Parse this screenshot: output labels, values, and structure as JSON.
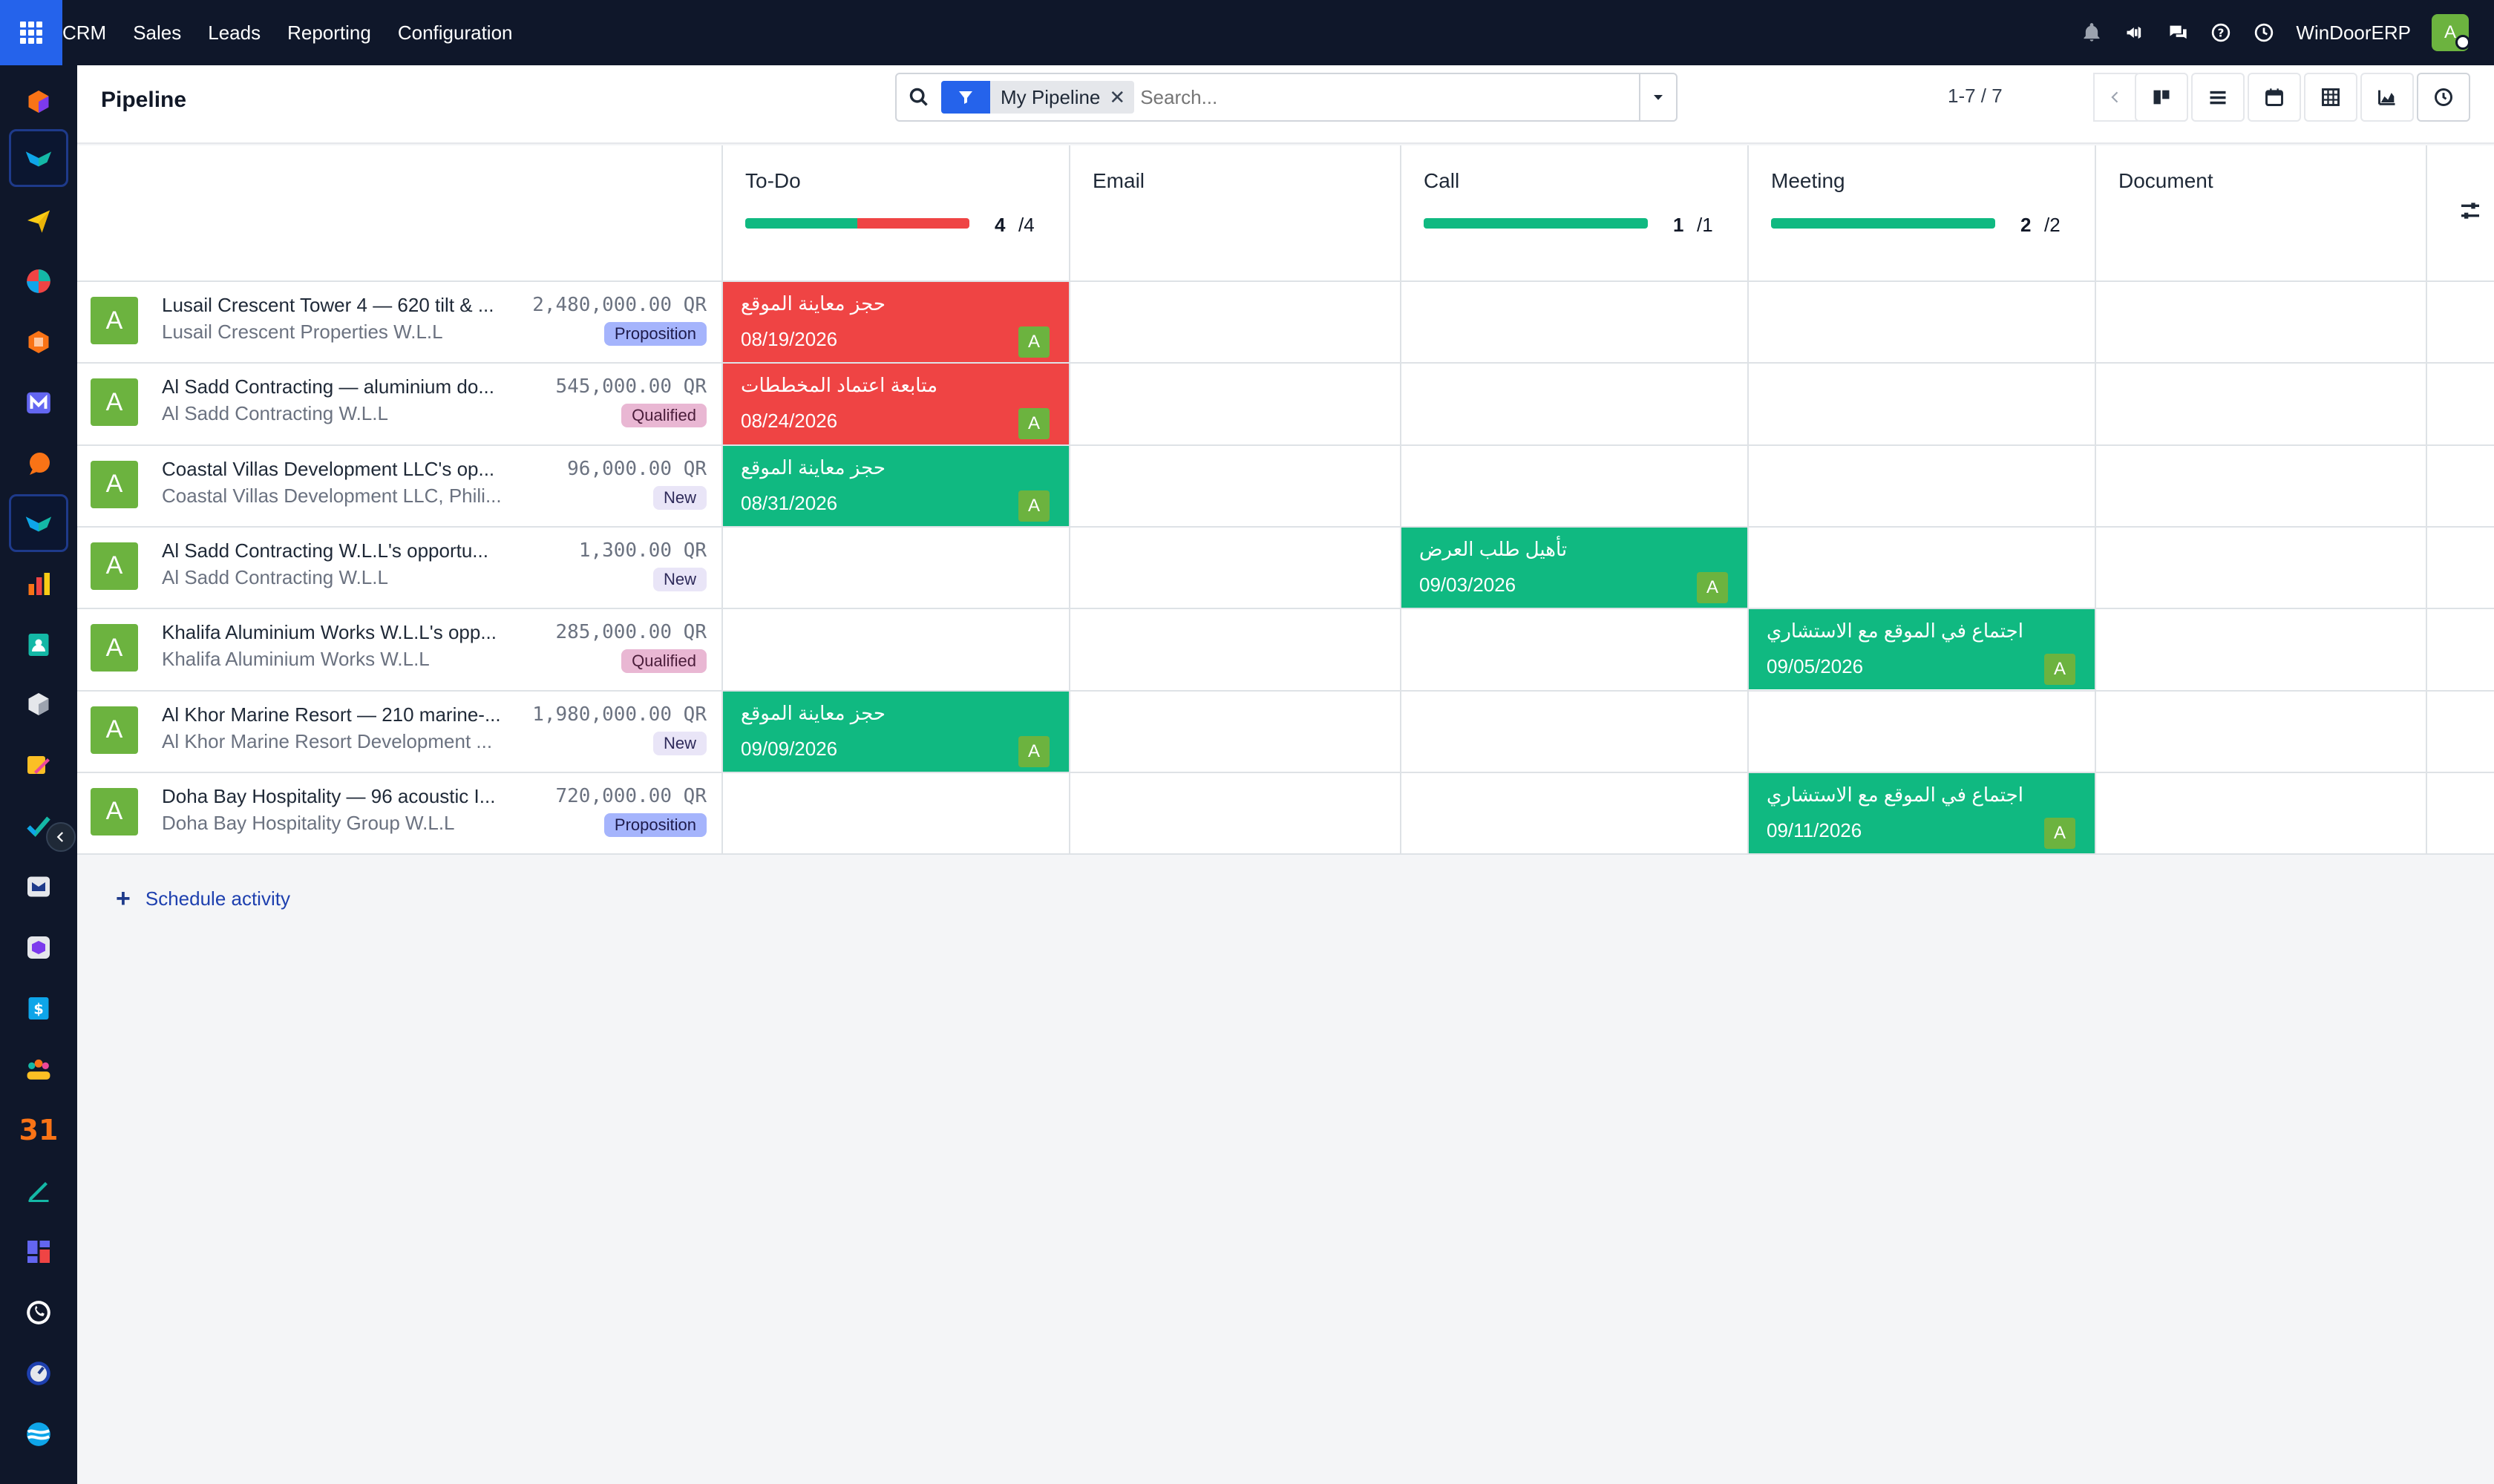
{
  "topnav": {
    "brand": "CRM",
    "menu": [
      "Sales",
      "Leads",
      "Reporting",
      "Configuration"
    ],
    "company": "WinDoorERP",
    "user_initial": "A",
    "icons": [
      "bell-icon",
      "megaphone-icon",
      "chat-icon",
      "help-icon",
      "clock-icon"
    ]
  },
  "sidebar": {
    "apps": [
      "cube-app",
      "crm-app",
      "send-app",
      "pie-app",
      "box-app",
      "mail-app",
      "chat-app",
      "crm-app-2",
      "chart-app",
      "contacts-app",
      "package-app",
      "sign-app",
      "task-app",
      "knowledge-app",
      "inventory-app",
      "invoice-app",
      "team-app",
      "calendar-app",
      "pen-app",
      "dashboard-app",
      "whatsapp-app",
      "compass-app",
      "discuss-app"
    ],
    "calendar_label": "31"
  },
  "control": {
    "title": "Pipeline",
    "filter_label": "My Pipeline",
    "search_placeholder": "Search...",
    "pager": "1-7 / 7"
  },
  "activity_types": [
    {
      "name": "To-Do",
      "done": 4,
      "total": "/4",
      "green_frac": 0.5,
      "red_frac": 0.5
    },
    {
      "name": "Email",
      "done": "",
      "total": ""
    },
    {
      "name": "Call",
      "done": 1,
      "total": "/1",
      "green_frac": 1.0,
      "red_frac": 0
    },
    {
      "name": "Meeting",
      "done": 2,
      "total": "/2",
      "green_frac": 1.0,
      "red_frac": 0
    },
    {
      "name": "Document",
      "done": "",
      "total": ""
    }
  ],
  "leads": [
    {
      "name": "Lusail Crescent Tower 4 — 620 tilt & ...",
      "partner": "Lusail Crescent Properties W.L.L",
      "revenue": "2,480,000.00 QR",
      "stage": "Proposition",
      "avatar": "A"
    },
    {
      "name": "Al Sadd Contracting — aluminium do...",
      "partner": "Al Sadd Contracting W.L.L",
      "revenue": "545,000.00 QR",
      "stage": "Qualified",
      "avatar": "A"
    },
    {
      "name": "Coastal Villas Development LLC's op...",
      "partner": "Coastal Villas Development LLC, Phili...",
      "revenue": "96,000.00 QR",
      "stage": "New",
      "avatar": "A"
    },
    {
      "name": "Al Sadd Contracting W.L.L's opportu...",
      "partner": "Al Sadd Contracting W.L.L",
      "revenue": "1,300.00 QR",
      "stage": "New",
      "avatar": "A"
    },
    {
      "name": "Khalifa Aluminium Works W.L.L's opp...",
      "partner": "Khalifa Aluminium Works W.L.L",
      "revenue": "285,000.00 QR",
      "stage": "Qualified",
      "avatar": "A"
    },
    {
      "name": "Al Khor Marine Resort — 210 marine-...",
      "partner": "Al Khor Marine Resort Development ...",
      "revenue": "1,980,000.00 QR",
      "stage": "New",
      "avatar": "A"
    },
    {
      "name": "Doha Bay Hospitality — 96 acoustic I...",
      "partner": "Doha Bay Hospitality Group W.L.L",
      "revenue": "720,000.00 QR",
      "stage": "Proposition",
      "avatar": "A"
    }
  ],
  "activities": [
    {
      "row": 0,
      "col": 0,
      "title": "حجز معاينة الموقع",
      "date": "08/19/2026",
      "state": "overdue",
      "avatar": "A"
    },
    {
      "row": 1,
      "col": 0,
      "title": "متابعة اعتماد المخططات",
      "date": "08/24/2026",
      "state": "overdue",
      "avatar": "A"
    },
    {
      "row": 2,
      "col": 0,
      "title": "حجز معاينة الموقع",
      "date": "08/31/2026",
      "state": "planned",
      "avatar": "A"
    },
    {
      "row": 3,
      "col": 2,
      "title": "تأهيل طلب العرض",
      "date": "09/03/2026",
      "state": "planned",
      "avatar": "A"
    },
    {
      "row": 4,
      "col": 3,
      "title": "اجتماع في الموقع مع الاستشاري",
      "date": "09/05/2026",
      "state": "planned",
      "avatar": "A"
    },
    {
      "row": 5,
      "col": 0,
      "title": "حجز معاينة الموقع",
      "date": "09/09/2026",
      "state": "planned",
      "avatar": "A"
    },
    {
      "row": 6,
      "col": 3,
      "title": "اجتماع في الموقع مع الاستشاري",
      "date": "09/11/2026",
      "state": "planned",
      "avatar": "A"
    }
  ],
  "footer": {
    "schedule_label": "Schedule activity"
  },
  "colors": {
    "accent": "#2563eb",
    "overdue": "#ef4444",
    "planned": "#10b981",
    "nav_bg": "#0f172a"
  }
}
